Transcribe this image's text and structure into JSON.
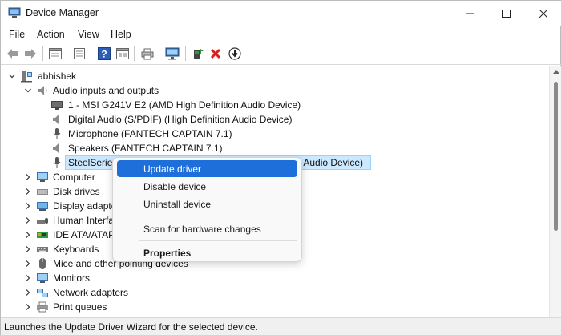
{
  "window": {
    "title": "Device Manager",
    "controls": {
      "minimize": "minimize",
      "maximize": "maximize",
      "close": "close"
    }
  },
  "menu": {
    "items": [
      "File",
      "Action",
      "View",
      "Help"
    ]
  },
  "toolbar": {
    "buttons": [
      "back-icon",
      "forward-icon",
      "properties-grid-icon",
      "properties-sheet-icon",
      "help-icon",
      "show-hidden-icon",
      "print-icon",
      "monitor-scan-icon",
      "update-driver-icon",
      "uninstall-icon",
      "download-icon"
    ]
  },
  "tree": {
    "root": "abhishek",
    "audio": {
      "label": "Audio inputs and outputs",
      "children": [
        "1 - MSI G241V E2 (AMD High Definition Audio Device)",
        "Digital Audio (S/PDIF) (High Definition Audio Device)",
        "Microphone (FANTECH CAPTAIN 7.1)",
        "Speakers (FANTECH CAPTAIN 7.1)",
        "SteelSeries",
        "l Audio Device)"
      ]
    },
    "categories": [
      "Computer",
      "Disk drives",
      "Display adapte",
      "Human Interfa",
      "IDE ATA/ATAPI",
      "Keyboards",
      "Mice and other pointing devices",
      "Monitors",
      "Network adapters",
      "Print queues"
    ]
  },
  "context_menu": {
    "items": [
      "Update driver",
      "Disable device",
      "Uninstall device",
      "Scan for hardware changes",
      "Properties"
    ]
  },
  "status": {
    "text": "Launches the Update Driver Wizard for the selected device."
  },
  "colors": {
    "selection_bg": "#cce8ff",
    "menu_highlight": "#1e6fd9",
    "delete_red": "#d81e1e",
    "green": "#2e9a3c",
    "blue": "#1f5fbf"
  }
}
